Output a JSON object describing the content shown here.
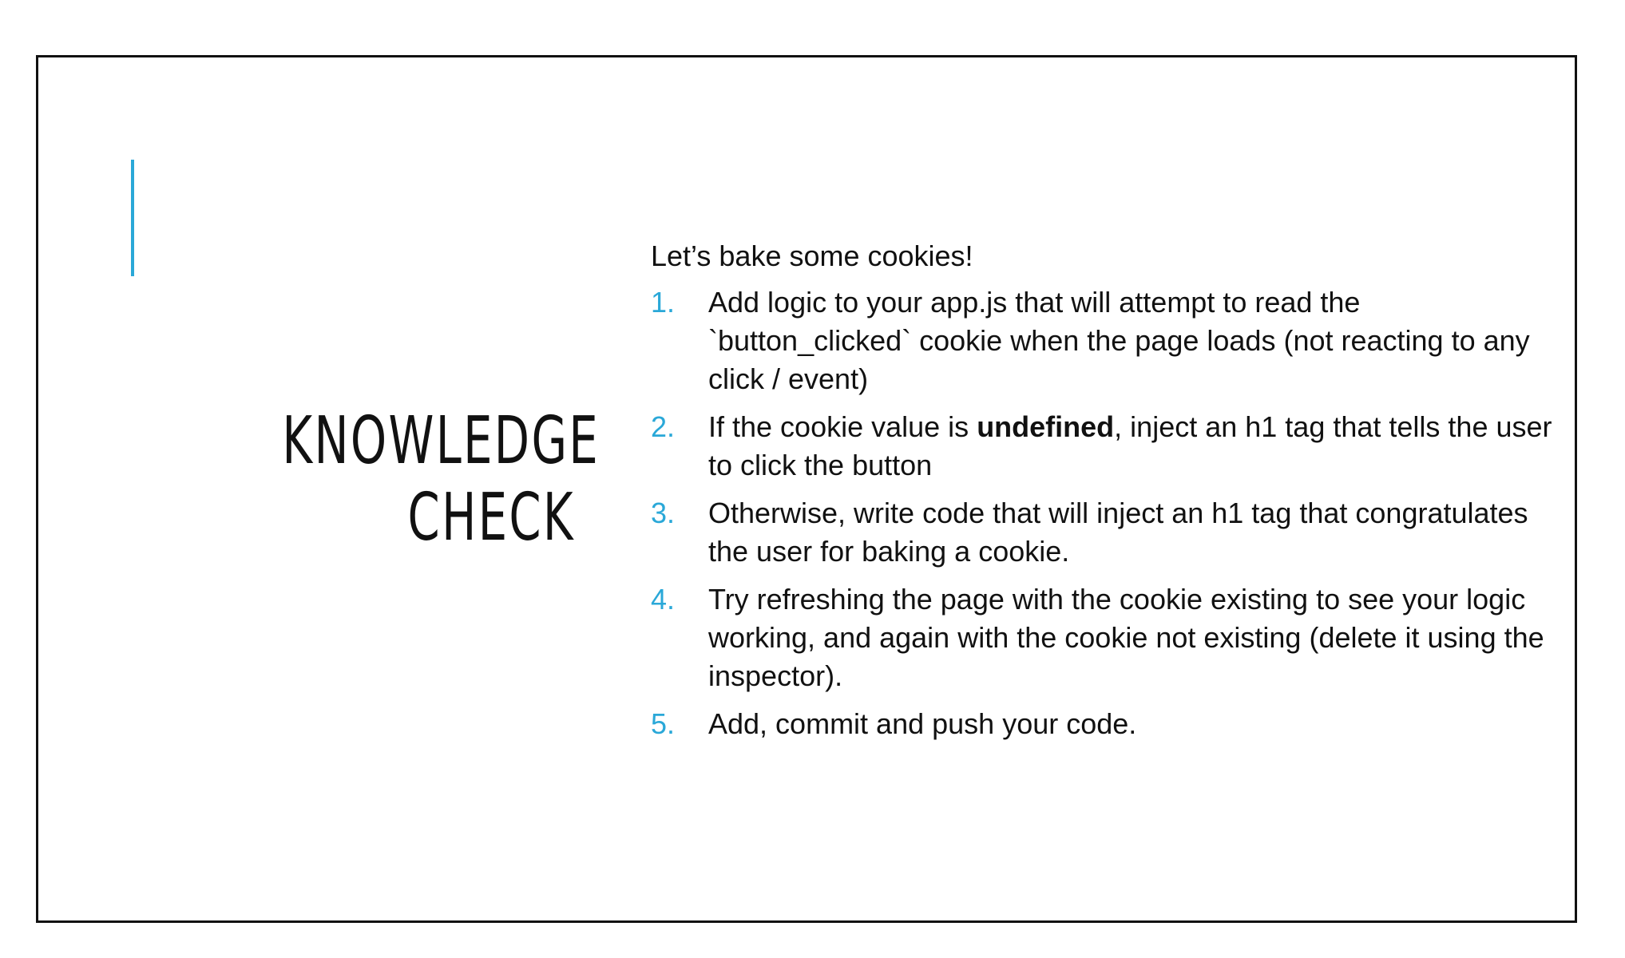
{
  "colors": {
    "accent": "#2aa8d8",
    "text": "#111111",
    "border": "#111111"
  },
  "slide": {
    "title_lines": [
      "KNOWLEDGE",
      "CHECK"
    ],
    "intro": "Let’s bake some cookies!",
    "steps": [
      {
        "number": "1.",
        "text_before": "Add logic to your app.js that will attempt to read the `button_clicked` cookie when the page loads (not reacting to any click / event)",
        "bold": "",
        "text_after": ""
      },
      {
        "number": "2.",
        "text_before": "If the cookie value is ",
        "bold": "undefined",
        "text_after": ", inject an h1 tag that tells the user to click the button"
      },
      {
        "number": "3.",
        "text_before": "Otherwise, write code that will inject an h1 tag that congratulates the user for baking a cookie.",
        "bold": "",
        "text_after": ""
      },
      {
        "number": "4.",
        "text_before": "Try refreshing the page with the cookie existing to see your logic working, and again with the cookie not existing (delete it using the inspector).",
        "bold": "",
        "text_after": ""
      },
      {
        "number": "5.",
        "text_before": "Add, commit and push your code.",
        "bold": "",
        "text_after": ""
      }
    ]
  }
}
